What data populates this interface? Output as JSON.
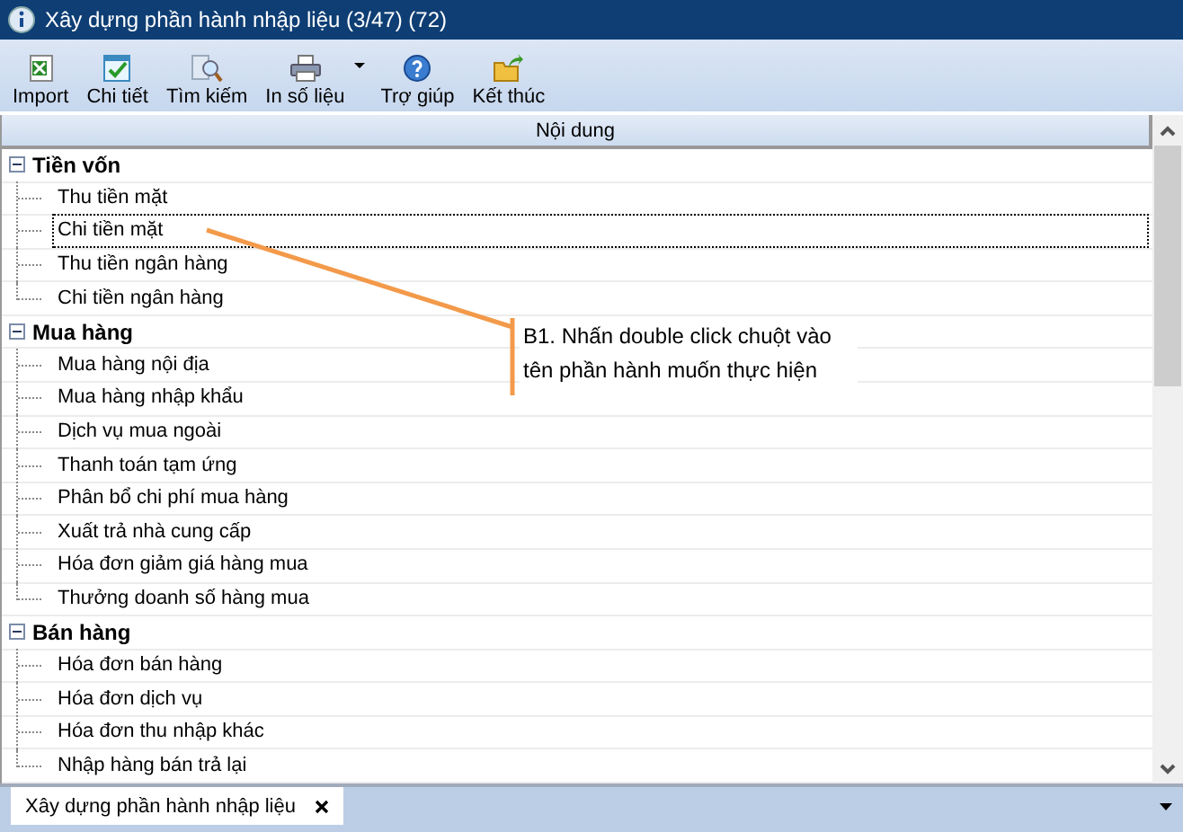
{
  "window": {
    "title": "Xây dựng phần hành nhập liệu (3/47) (72)"
  },
  "toolbar": [
    {
      "label": "Import",
      "has_menu": false
    },
    {
      "label": "Chi tiết",
      "has_menu": false
    },
    {
      "label": "Tìm kiếm",
      "has_menu": false
    },
    {
      "label": "In số liệu",
      "has_menu": true
    },
    {
      "label": "Trợ giúp",
      "has_menu": false
    },
    {
      "label": "Kết thúc",
      "has_menu": false
    }
  ],
  "table": {
    "column": "Nội dung",
    "groups": [
      {
        "label": "Tiền vốn",
        "expanded": true,
        "children": [
          {
            "label": "Thu tiền mặt",
            "selected": false
          },
          {
            "label": "Chi tiền mặt",
            "selected": true
          },
          {
            "label": "Thu tiền ngân hàng",
            "selected": false
          },
          {
            "label": "Chi tiền ngân hàng",
            "selected": false
          }
        ]
      },
      {
        "label": "Mua hàng",
        "expanded": true,
        "children": [
          {
            "label": "Mua hàng nội địa",
            "selected": false
          },
          {
            "label": "Mua hàng nhập khẩu",
            "selected": false
          },
          {
            "label": "Dịch vụ mua ngoài",
            "selected": false
          },
          {
            "label": "Thanh toán tạm ứng",
            "selected": false
          },
          {
            "label": "Phân bổ chi phí mua hàng",
            "selected": false
          },
          {
            "label": "Xuất trả nhà cung cấp",
            "selected": false
          },
          {
            "label": "Hóa đơn giảm giá hàng mua",
            "selected": false
          },
          {
            "label": "Thưởng doanh số hàng mua",
            "selected": false
          }
        ]
      },
      {
        "label": "Bán hàng",
        "expanded": true,
        "children": [
          {
            "label": "Hóa đơn bán hàng",
            "selected": false
          },
          {
            "label": "Hóa đơn dịch vụ",
            "selected": false
          },
          {
            "label": "Hóa đơn thu nhập khác",
            "selected": false
          },
          {
            "label": "Nhập hàng bán trả lại",
            "selected": false
          }
        ]
      }
    ]
  },
  "callout": {
    "text": "B1. Nhấn double click chuột vào tên phần hành muốn thực hiện"
  },
  "bottom_tabs": [
    {
      "label": "Xây dựng phần hành nhập liệu",
      "selected": true
    }
  ]
}
